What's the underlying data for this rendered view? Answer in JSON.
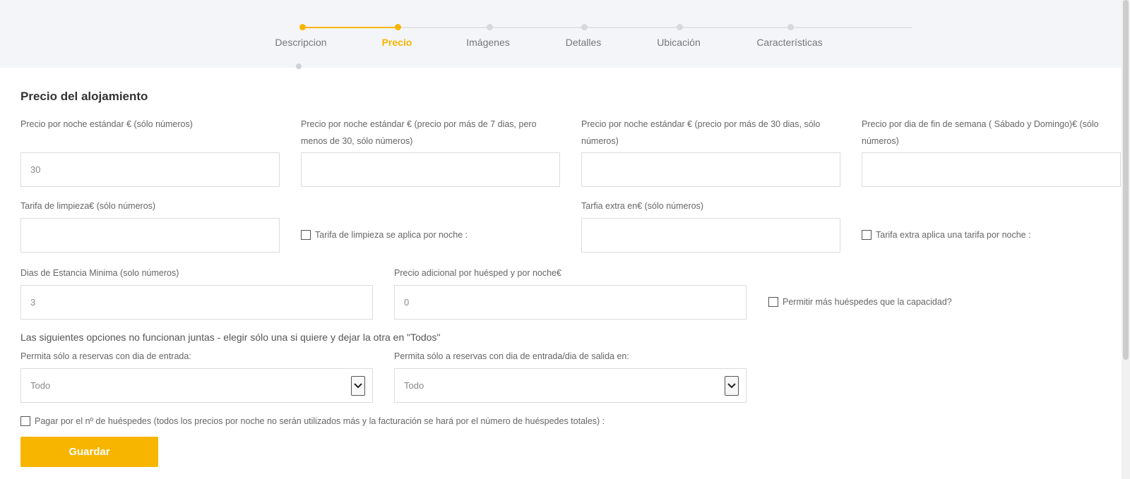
{
  "stepper": {
    "steps": [
      {
        "label": "Descripcion",
        "state": "done"
      },
      {
        "label": "Precio",
        "state": "current"
      },
      {
        "label": "Imágenes",
        "state": "pending"
      },
      {
        "label": "Detalles",
        "state": "pending"
      },
      {
        "label": "Ubicación",
        "state": "pending"
      },
      {
        "label": "Características",
        "state": "pending"
      }
    ]
  },
  "form": {
    "title": "Precio del alojamiento",
    "fields": {
      "price_night": {
        "label": "Precio por noche estándar € (sólo números)",
        "value": "30"
      },
      "price_week": {
        "label": "Precio por noche estándar € (precio por más de 7 dias, pero menos de 30, sólo números)",
        "value": ""
      },
      "price_month": {
        "label": "Precio por noche estándar € (precio por más de 30 dias, sólo números)",
        "value": ""
      },
      "price_weekend": {
        "label": "Precio por dia de fin de semana ( Sábado y Domingo)€ (sólo números)",
        "value": ""
      },
      "cleaning_fee": {
        "label": "Tarifa de limpieza€ (sólo números)",
        "value": ""
      },
      "extra_fee": {
        "label": "Tarfia extra en€ (sólo números)",
        "value": ""
      },
      "min_stay": {
        "label": "Dias de Estancia Minima (solo números)",
        "value": "3"
      },
      "extra_guest_price": {
        "label": "Precio adicional por huésped y por noche€",
        "value": "0"
      }
    },
    "checkboxes": {
      "cleaning_per_night": {
        "label": "Tarifa de limpieza se aplica por noche :",
        "checked": false
      },
      "extra_per_night": {
        "label": "Tarifa extra aplica una tarifa por noche :",
        "checked": false
      },
      "allow_more_guests": {
        "label": "Permitir más huéspedes que la capacidad?",
        "checked": false
      },
      "pay_by_guests": {
        "label": "Pagar por el nº de huéspedes (todos los precios por noche no serán utilizados más y la facturación se hará por el número de huéspedes totales) :",
        "checked": false
      }
    },
    "note": "Las siguientes opciones no funcionan juntas - elegir sólo una si quiere y dejar la otra en \"Todos\"",
    "selects": {
      "checkin_day": {
        "label": "Permita sólo a reservas con dia de entrada:",
        "value": "Todo"
      },
      "checkin_checkout_day": {
        "label": "Permita sólo a reservas con dia de entrada/dia de salida en:",
        "value": "Todo"
      }
    },
    "save_label": "Guardar"
  },
  "colors": {
    "accent": "#f7b500",
    "header_bg": "#f4f5f8",
    "border": "#dcdcdc"
  }
}
